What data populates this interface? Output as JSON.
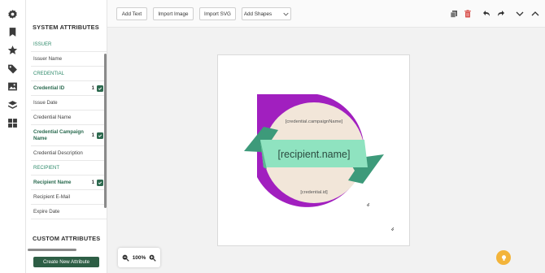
{
  "rail": {
    "icons": [
      "settings-icon",
      "bookmark-icon",
      "star-icon",
      "tag-icon",
      "image-icon",
      "layers-icon",
      "grid-icon"
    ]
  },
  "panel": {
    "system_title": "SYSTEM ATTRIBUTES",
    "custom_title": "CUSTOM ATTRIBUTES",
    "create_button": "Create New Attribute",
    "rows": [
      {
        "label": "ISSUER",
        "section": true
      },
      {
        "label": "Issuer Name"
      },
      {
        "label": "CREDENTIAL",
        "section": true
      },
      {
        "label": "Credential ID",
        "active": true,
        "count": "1",
        "checked": true
      },
      {
        "label": "Issue Date"
      },
      {
        "label": "Credential Name"
      },
      {
        "label": "Credential Campaign Name",
        "active": true,
        "count": "1",
        "checked": true
      },
      {
        "label": "Credential Description"
      },
      {
        "label": "RECIPIENT",
        "section": true
      },
      {
        "label": "Recipient Name",
        "active": true,
        "count": "1",
        "checked": true
      },
      {
        "label": "Recipient E-Mail"
      },
      {
        "label": "Expire Date"
      }
    ]
  },
  "toolbar": {
    "add_text": "Add Text",
    "import_image": "Import Image",
    "import_svg": "Import SVG",
    "add_shapes": "Add Shapes"
  },
  "canvas": {
    "campaign_placeholder": "[credential.campaignName]",
    "recipient_placeholder": "[recipient.name]",
    "id_placeholder": "[credential.id]"
  },
  "zoom": {
    "level": "100%"
  },
  "colors": {
    "brand_green": "#2d5e45",
    "accent_purple": "#a11fbf",
    "ribbon_mint": "#8fe3c0",
    "circle_cream": "#f2e6d9",
    "help_yellow": "#f3b43a",
    "delete_red": "#d9534f"
  }
}
